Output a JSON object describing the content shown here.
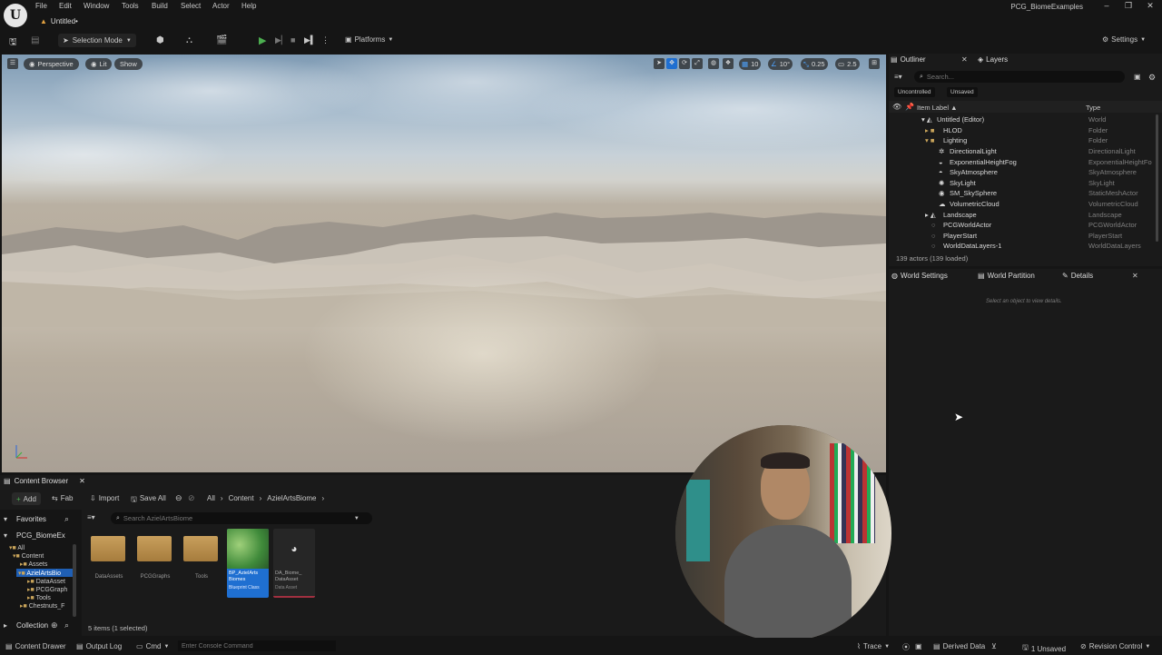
{
  "menu": {
    "items": [
      "File",
      "Edit",
      "Window",
      "Tools",
      "Build",
      "Select",
      "Actor",
      "Help"
    ]
  },
  "document_tab": "Untitled•",
  "window_title": "PCG_BiomeExamples",
  "toolbar": {
    "selection_mode": "Selection Mode",
    "platforms": "Platforms",
    "settings": "Settings"
  },
  "viewport": {
    "perspective": "Perspective",
    "lit": "Lit",
    "show": "Show",
    "grid_size": "10",
    "rotation_snap": "10°",
    "scale_snap": "0.25",
    "camera_speed": "2.5"
  },
  "outliner": {
    "tab_outliner": "Outliner",
    "tab_layers": "Layers",
    "search_placeholder": "Search...",
    "filter_uncontrolled": "Uncontrolled",
    "filter_unsaved": "Unsaved",
    "col_label": "Item Label ▲",
    "col_type": "Type",
    "rows": [
      {
        "label": "Untitled (Editor)",
        "type": "World"
      },
      {
        "label": "HLOD",
        "type": "Folder"
      },
      {
        "label": "Lighting",
        "type": "Folder"
      },
      {
        "label": "DirectionalLight",
        "type": "DirectionalLight"
      },
      {
        "label": "ExponentialHeightFog",
        "type": "ExponentialHeightFo"
      },
      {
        "label": "SkyAtmosphere",
        "type": "SkyAtmosphere"
      },
      {
        "label": "SkyLight",
        "type": "SkyLight"
      },
      {
        "label": "SM_SkySphere",
        "type": "StaticMeshActor"
      },
      {
        "label": "VolumetricCloud",
        "type": "VolumetricCloud"
      },
      {
        "label": "Landscape",
        "type": "Landscape"
      },
      {
        "label": "PCGWorldActor",
        "type": "PCGWorldActor"
      },
      {
        "label": "PlayerStart",
        "type": "PlayerStart"
      },
      {
        "label": "WorldDataLayers-1",
        "type": "WorldDataLayers"
      }
    ],
    "actor_count": "139 actors (139 loaded)"
  },
  "details": {
    "tab_world_settings": "World Settings",
    "tab_world_partition": "World Partition",
    "tab_details": "Details",
    "empty_hint": "Select an object to view details."
  },
  "content_browser": {
    "title": "Content Browser",
    "add": "Add",
    "fab": "Fab",
    "import": "Import",
    "save_all": "Save All",
    "path": [
      "All",
      "Content",
      "AzielArtsBiome"
    ],
    "search_placeholder": "Search AzielArtsBiome",
    "favorites": "Favorites",
    "project": "PCG_BiomeEx",
    "tree": [
      "All",
      "Content",
      "Assets",
      "AzielArtsBio",
      "DataAsset",
      "PCGGraph",
      "Tools",
      "Chestnuts_F"
    ],
    "collections": "Collection",
    "assets": [
      {
        "name": "DataAssets",
        "kind": "folder"
      },
      {
        "name": "PCGGraphs",
        "kind": "folder"
      },
      {
        "name": "Tools",
        "kind": "folder"
      },
      {
        "name": "BP_AzielArts Biomes",
        "kind": "blueprint",
        "subtype": "Blueprint Class"
      },
      {
        "name": "DA_Biome_ DataAsset",
        "kind": "dataasset",
        "subtype": "Data Asset"
      }
    ],
    "item_count": "5 items (1 selected)"
  },
  "statusbar": {
    "content_drawer": "Content Drawer",
    "output_log": "Output Log",
    "cmd": "Cmd",
    "console_placeholder": "Enter Console Command",
    "trace": "Trace",
    "derived_data": "Derived Data",
    "unsaved": "1 Unsaved",
    "revision_control": "Revision Control"
  }
}
